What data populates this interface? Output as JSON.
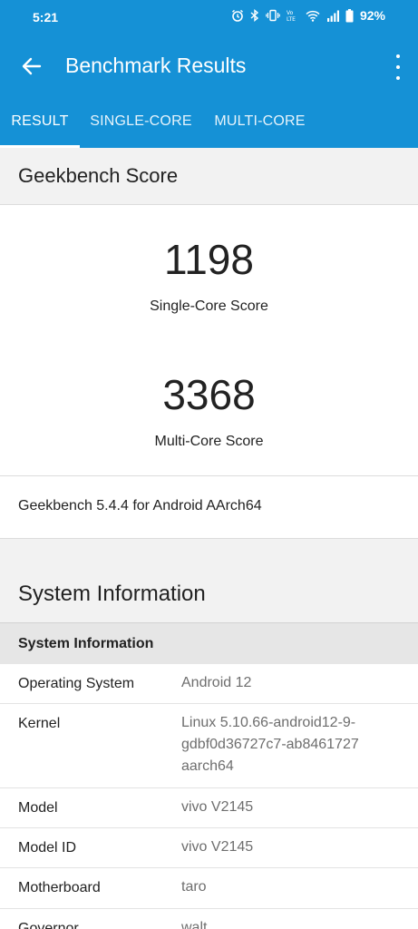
{
  "status_bar": {
    "time": "5:21",
    "battery": "92%",
    "icons": [
      "alarm-icon",
      "bluetooth-icon",
      "vibrate-icon",
      "volte-icon",
      "wifi-icon",
      "signal-icon",
      "battery-icon"
    ]
  },
  "app_bar": {
    "title": "Benchmark Results",
    "back_icon": "arrow-back-icon",
    "menu_icon": "more-vert-icon",
    "color": "#1591d6"
  },
  "tabs": [
    {
      "label": "RESULT",
      "selected": true
    },
    {
      "label": "SINGLE-CORE",
      "selected": false
    },
    {
      "label": "MULTI-CORE",
      "selected": false
    }
  ],
  "score_section": {
    "header": "Geekbench Score",
    "single_core_score": "1198",
    "single_core_label": "Single-Core Score",
    "multi_core_score": "3368",
    "multi_core_label": "Multi-Core Score",
    "version": "Geekbench 5.4.4 for Android AArch64"
  },
  "system_info": {
    "header": "System Information",
    "subheader": "System Information",
    "rows": [
      {
        "key": "Operating System",
        "value": "Android 12"
      },
      {
        "key": "Kernel",
        "value": "Linux 5.10.66-android12-9-gdbf0d36727c7-ab8461727 aarch64"
      },
      {
        "key": "Model",
        "value": "vivo V2145"
      },
      {
        "key": "Model ID",
        "value": "vivo V2145"
      },
      {
        "key": "Motherboard",
        "value": "taro"
      },
      {
        "key": "Governor",
        "value": "walt"
      }
    ]
  }
}
